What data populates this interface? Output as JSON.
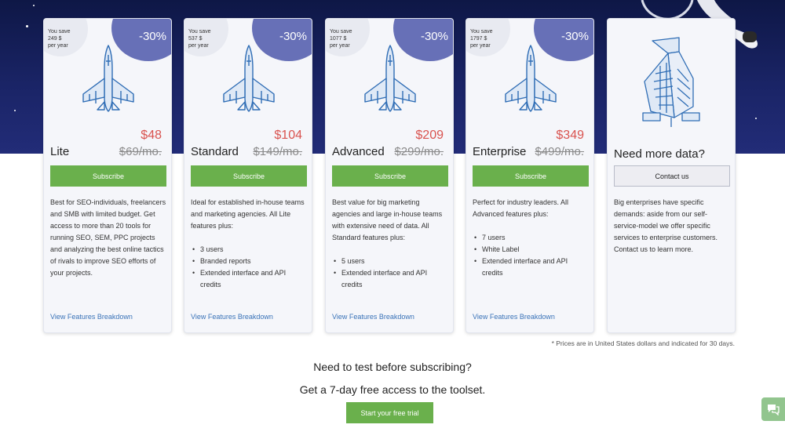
{
  "plans": [
    {
      "save_line1": "You save",
      "save_amount": "249 $",
      "save_period": "per year",
      "discount": "-30%",
      "price": "$48",
      "name": "Lite",
      "old_price": "$69/mo.",
      "subscribe_label": "Subscribe",
      "description": "Best for SEO-individuals, freelancers and SMB with limited budget. Get access to more than 20 tools for running SEO, SEM, PPC projects and analyzing the best online tactics of rivals to improve SEO efforts of your projects.",
      "features": [],
      "link": "View Features Breakdown"
    },
    {
      "save_line1": "You save",
      "save_amount": "537 $",
      "save_period": "per year",
      "discount": "-30%",
      "price": "$104",
      "name": "Standard",
      "old_price": "$149/mo.",
      "subscribe_label": "Subscribe",
      "description": "Ideal for established in-house teams and marketing agencies. All Lite features plus:",
      "features": [
        "3 users",
        "Branded reports",
        "Extended interface and API credits"
      ],
      "link": "View Features Breakdown"
    },
    {
      "save_line1": "You save",
      "save_amount": "1077 $",
      "save_period": "per year",
      "discount": "-30%",
      "price": "$209",
      "name": "Advanced",
      "old_price": "$299/mo.",
      "subscribe_label": "Subscribe",
      "description": "Best value for big marketing agencies and large in-house teams with extensive need of data. All Standard features plus:",
      "features": [
        "5 users",
        "Extended interface and API credits"
      ],
      "link": "View Features Breakdown"
    },
    {
      "save_line1": "You save",
      "save_amount": "1797 $",
      "save_period": "per year",
      "discount": "-30%",
      "price": "$349",
      "name": "Enterprise",
      "old_price": "$499/mo.",
      "subscribe_label": "Subscribe",
      "description": "Perfect for industry leaders. All Advanced features plus:",
      "features": [
        "7 users",
        "White Label",
        "Extended interface and API credits"
      ],
      "link": "View Features Breakdown"
    }
  ],
  "custom": {
    "title": "Need more data?",
    "button": "Contact us",
    "description": "Big enterprises have specific demands: aside from our self-service-model we offer specific services to enterprise customers. Contact us to learn more."
  },
  "footnote": "* Prices are in United States dollars and indicated for 30 days.",
  "cta": {
    "question": "Need to test before subscribing?",
    "subtitle": "Get a 7-day free access to the toolset.",
    "button": "Start your free trial"
  },
  "icons": {
    "plan_art": "jet-fighter-icon",
    "custom_art": "building-icon",
    "chat": "chat-icon"
  },
  "colors": {
    "accent_green": "#6ab04c",
    "discount_badge": "#6770b7",
    "price_red": "#d9534f",
    "link_blue": "#3a73b8",
    "hero_navy": "#1a2466"
  }
}
